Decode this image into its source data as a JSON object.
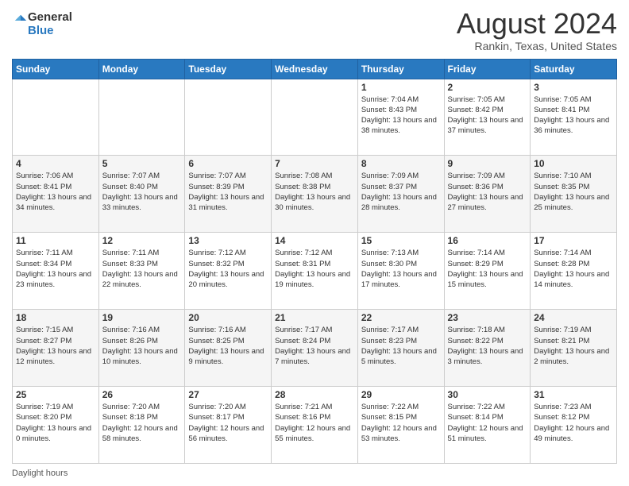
{
  "logo": {
    "general": "General",
    "blue": "Blue"
  },
  "header": {
    "title": "August 2024",
    "location": "Rankin, Texas, United States"
  },
  "footer": {
    "daylight_label": "Daylight hours"
  },
  "days_of_week": [
    "Sunday",
    "Monday",
    "Tuesday",
    "Wednesday",
    "Thursday",
    "Friday",
    "Saturday"
  ],
  "weeks": [
    [
      {
        "day": "",
        "info": ""
      },
      {
        "day": "",
        "info": ""
      },
      {
        "day": "",
        "info": ""
      },
      {
        "day": "",
        "info": ""
      },
      {
        "day": "1",
        "info": "Sunrise: 7:04 AM\nSunset: 8:43 PM\nDaylight: 13 hours\nand 38 minutes."
      },
      {
        "day": "2",
        "info": "Sunrise: 7:05 AM\nSunset: 8:42 PM\nDaylight: 13 hours\nand 37 minutes."
      },
      {
        "day": "3",
        "info": "Sunrise: 7:05 AM\nSunset: 8:41 PM\nDaylight: 13 hours\nand 36 minutes."
      }
    ],
    [
      {
        "day": "4",
        "info": "Sunrise: 7:06 AM\nSunset: 8:41 PM\nDaylight: 13 hours\nand 34 minutes."
      },
      {
        "day": "5",
        "info": "Sunrise: 7:07 AM\nSunset: 8:40 PM\nDaylight: 13 hours\nand 33 minutes."
      },
      {
        "day": "6",
        "info": "Sunrise: 7:07 AM\nSunset: 8:39 PM\nDaylight: 13 hours\nand 31 minutes."
      },
      {
        "day": "7",
        "info": "Sunrise: 7:08 AM\nSunset: 8:38 PM\nDaylight: 13 hours\nand 30 minutes."
      },
      {
        "day": "8",
        "info": "Sunrise: 7:09 AM\nSunset: 8:37 PM\nDaylight: 13 hours\nand 28 minutes."
      },
      {
        "day": "9",
        "info": "Sunrise: 7:09 AM\nSunset: 8:36 PM\nDaylight: 13 hours\nand 27 minutes."
      },
      {
        "day": "10",
        "info": "Sunrise: 7:10 AM\nSunset: 8:35 PM\nDaylight: 13 hours\nand 25 minutes."
      }
    ],
    [
      {
        "day": "11",
        "info": "Sunrise: 7:11 AM\nSunset: 8:34 PM\nDaylight: 13 hours\nand 23 minutes."
      },
      {
        "day": "12",
        "info": "Sunrise: 7:11 AM\nSunset: 8:33 PM\nDaylight: 13 hours\nand 22 minutes."
      },
      {
        "day": "13",
        "info": "Sunrise: 7:12 AM\nSunset: 8:32 PM\nDaylight: 13 hours\nand 20 minutes."
      },
      {
        "day": "14",
        "info": "Sunrise: 7:12 AM\nSunset: 8:31 PM\nDaylight: 13 hours\nand 19 minutes."
      },
      {
        "day": "15",
        "info": "Sunrise: 7:13 AM\nSunset: 8:30 PM\nDaylight: 13 hours\nand 17 minutes."
      },
      {
        "day": "16",
        "info": "Sunrise: 7:14 AM\nSunset: 8:29 PM\nDaylight: 13 hours\nand 15 minutes."
      },
      {
        "day": "17",
        "info": "Sunrise: 7:14 AM\nSunset: 8:28 PM\nDaylight: 13 hours\nand 14 minutes."
      }
    ],
    [
      {
        "day": "18",
        "info": "Sunrise: 7:15 AM\nSunset: 8:27 PM\nDaylight: 13 hours\nand 12 minutes."
      },
      {
        "day": "19",
        "info": "Sunrise: 7:16 AM\nSunset: 8:26 PM\nDaylight: 13 hours\nand 10 minutes."
      },
      {
        "day": "20",
        "info": "Sunrise: 7:16 AM\nSunset: 8:25 PM\nDaylight: 13 hours\nand 9 minutes."
      },
      {
        "day": "21",
        "info": "Sunrise: 7:17 AM\nSunset: 8:24 PM\nDaylight: 13 hours\nand 7 minutes."
      },
      {
        "day": "22",
        "info": "Sunrise: 7:17 AM\nSunset: 8:23 PM\nDaylight: 13 hours\nand 5 minutes."
      },
      {
        "day": "23",
        "info": "Sunrise: 7:18 AM\nSunset: 8:22 PM\nDaylight: 13 hours\nand 3 minutes."
      },
      {
        "day": "24",
        "info": "Sunrise: 7:19 AM\nSunset: 8:21 PM\nDaylight: 13 hours\nand 2 minutes."
      }
    ],
    [
      {
        "day": "25",
        "info": "Sunrise: 7:19 AM\nSunset: 8:20 PM\nDaylight: 13 hours\nand 0 minutes."
      },
      {
        "day": "26",
        "info": "Sunrise: 7:20 AM\nSunset: 8:18 PM\nDaylight: 12 hours\nand 58 minutes."
      },
      {
        "day": "27",
        "info": "Sunrise: 7:20 AM\nSunset: 8:17 PM\nDaylight: 12 hours\nand 56 minutes."
      },
      {
        "day": "28",
        "info": "Sunrise: 7:21 AM\nSunset: 8:16 PM\nDaylight: 12 hours\nand 55 minutes."
      },
      {
        "day": "29",
        "info": "Sunrise: 7:22 AM\nSunset: 8:15 PM\nDaylight: 12 hours\nand 53 minutes."
      },
      {
        "day": "30",
        "info": "Sunrise: 7:22 AM\nSunset: 8:14 PM\nDaylight: 12 hours\nand 51 minutes."
      },
      {
        "day": "31",
        "info": "Sunrise: 7:23 AM\nSunset: 8:12 PM\nDaylight: 12 hours\nand 49 minutes."
      }
    ]
  ]
}
